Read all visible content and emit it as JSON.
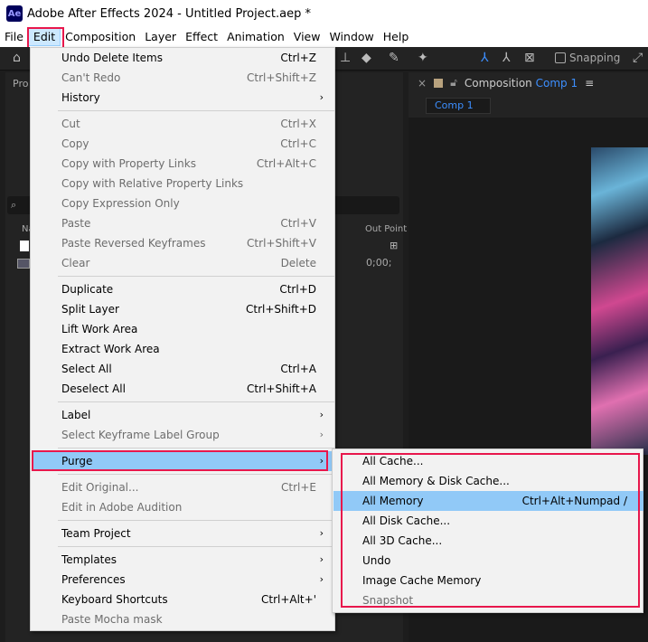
{
  "window": {
    "title": "Adobe After Effects 2024 - Untitled Project.aep *",
    "logo": "Ae"
  },
  "menubar": [
    "File",
    "Edit",
    "Composition",
    "Layer",
    "Effect",
    "Animation",
    "View",
    "Window",
    "Help"
  ],
  "toolbar": {
    "snapping": "Snapping"
  },
  "project_panel": {
    "tab": "Pro",
    "column_name": "Na",
    "out_point_header": "Out Point",
    "out_point_value": "0;00;"
  },
  "composition_panel": {
    "label": "Composition",
    "comp_name": "Comp 1",
    "tab": "Comp 1"
  },
  "edit_menu": [
    {
      "label": "Undo Delete Items",
      "shortcut": "Ctrl+Z"
    },
    {
      "label": "Can't Redo",
      "shortcut": "Ctrl+Shift+Z",
      "disabled": true
    },
    {
      "label": "History",
      "submenu": true
    },
    {
      "sep": true
    },
    {
      "label": "Cut",
      "shortcut": "Ctrl+X",
      "disabled": true
    },
    {
      "label": "Copy",
      "shortcut": "Ctrl+C",
      "disabled": true
    },
    {
      "label": "Copy with Property Links",
      "shortcut": "Ctrl+Alt+C",
      "disabled": true
    },
    {
      "label": "Copy with Relative Property Links",
      "disabled": true
    },
    {
      "label": "Copy Expression Only",
      "disabled": true
    },
    {
      "label": "Paste",
      "shortcut": "Ctrl+V",
      "disabled": true
    },
    {
      "label": "Paste Reversed Keyframes",
      "shortcut": "Ctrl+Shift+V",
      "disabled": true
    },
    {
      "label": "Clear",
      "shortcut": "Delete",
      "disabled": true
    },
    {
      "sep": true
    },
    {
      "label": "Duplicate",
      "shortcut": "Ctrl+D"
    },
    {
      "label": "Split Layer",
      "shortcut": "Ctrl+Shift+D"
    },
    {
      "label": "Lift Work Area"
    },
    {
      "label": "Extract Work Area"
    },
    {
      "label": "Select All",
      "shortcut": "Ctrl+A"
    },
    {
      "label": "Deselect All",
      "shortcut": "Ctrl+Shift+A"
    },
    {
      "sep": true
    },
    {
      "label": "Label",
      "submenu": true
    },
    {
      "label": "Select Keyframe Label Group",
      "submenu": true,
      "disabled": true
    },
    {
      "sep": true
    },
    {
      "label": "Purge",
      "submenu": true,
      "highlighted": true
    },
    {
      "sep": true
    },
    {
      "label": "Edit Original...",
      "shortcut": "Ctrl+E",
      "disabled": true
    },
    {
      "label": "Edit in Adobe Audition",
      "disabled": true
    },
    {
      "sep": true
    },
    {
      "label": "Team Project",
      "submenu": true
    },
    {
      "sep": true
    },
    {
      "label": "Templates",
      "submenu": true
    },
    {
      "label": "Preferences",
      "submenu": true
    },
    {
      "label": "Keyboard Shortcuts",
      "shortcut": "Ctrl+Alt+'"
    },
    {
      "label": "Paste Mocha mask",
      "disabled": true
    }
  ],
  "purge_submenu": [
    {
      "label": "All Cache..."
    },
    {
      "label": "All Memory & Disk Cache..."
    },
    {
      "label": "All Memory",
      "shortcut": "Ctrl+Alt+Numpad /",
      "highlighted": true
    },
    {
      "label": "All Disk Cache..."
    },
    {
      "label": "All 3D Cache..."
    },
    {
      "label": "Undo"
    },
    {
      "label": "Image Cache Memory"
    },
    {
      "label": "Snapshot",
      "disabled": true
    }
  ],
  "colors": {
    "highlight": "#91c9f7",
    "annotation": "#e8174c",
    "accent": "#3d8fff"
  }
}
